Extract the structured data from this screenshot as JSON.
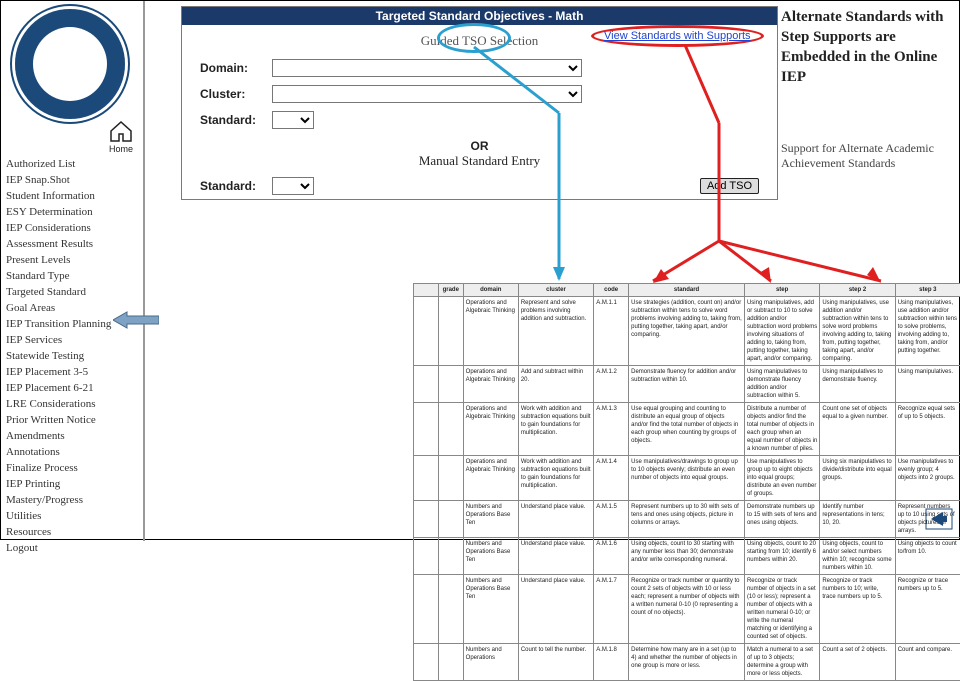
{
  "logo_alt": "West Virginia Department of Education",
  "home_label": "Home",
  "nav": {
    "items": [
      "Authorized List",
      "IEP Snap.Shot",
      "Student Information",
      "ESY Determination",
      "IEP Considerations",
      "Assessment Results",
      "Present Levels",
      "Standard Type",
      "Targeted Standard",
      "Goal Areas",
      "IEP Transition Planning",
      "IEP Services",
      "Statewide Testing",
      "IEP Placement 3-5",
      "IEP Placement 6-21",
      "LRE Considerations",
      "Prior Written Notice",
      "Amendments",
      "Annotations",
      "Finalize Process",
      "IEP Printing",
      "Mastery/Progress",
      "Utilities",
      "Resources",
      "Logout"
    ]
  },
  "form": {
    "header": "Targeted Standard Objectives - Math",
    "guided_sub": "Guided TSO Selection",
    "domain_label": "Domain:",
    "cluster_label": "Cluster:",
    "standard_label": "Standard:",
    "or_label": "OR",
    "manual_sub": "Manual Standard Entry",
    "add_btn": "Add TSO"
  },
  "link_text": "View Standards with Supports",
  "callout_text": "Alternate Standards with Step Supports are Embedded in the Online IEP",
  "support_text": "Support for Alternate Academic Achievement Standards",
  "table": {
    "headers": [
      "",
      "grade",
      "domain",
      "cluster",
      "code",
      "standard",
      "step",
      "step 2",
      "step 3"
    ],
    "rows": [
      [
        "",
        "",
        "Operations and Algebraic Thinking",
        "Represent and solve problems involving addition and subtraction.",
        "A.M.1.1",
        "Use strategies (addition, count on) and/or subtraction within tens to solve word problems involving adding to, taking from, putting together, taking apart, and/or comparing.",
        "Using manipulatives, add or subtract to 10 to solve addition and/or subtraction word problems involving situations of adding to, taking from, putting together, taking apart, and/or comparing.",
        "Using manipulatives, use addition and/or subtraction within tens to solve word problems involving adding to, taking from, putting together, taking apart, and/or comparing.",
        "Using manipulatives, use addition and/or subtraction within tens to solve problems, involving adding to, taking from, and/or putting together."
      ],
      [
        "",
        "",
        "Operations and Algebraic Thinking",
        "Add and subtract within 20.",
        "A.M.1.2",
        "Demonstrate fluency for addition and/or subtraction within 10.",
        "Using manipulatives to demonstrate fluency addition and/or subtraction within 5.",
        "Using manipulatives to demonstrate fluency.",
        "Using manipulatives."
      ],
      [
        "",
        "",
        "Operations and Algebraic Thinking",
        "Work with addition and subtraction equations built to gain foundations for multiplication.",
        "A.M.1.3",
        "Use equal grouping and counting to distribute an equal group of objects and/or find the total number of objects in each group when counting by groups of objects.",
        "Distribute a number of objects and/or find the total number of objects in each group when an equal number of objects in a known number of piles.",
        "Count one set of objects equal to a given number.",
        "Recognize equal sets of up to 5 objects."
      ],
      [
        "",
        "",
        "Operations and Algebraic Thinking",
        "Work with addition and subtraction equations built to gain foundations for multiplication.",
        "A.M.1.4",
        "Use manipulatives/drawings to group up to 10 objects evenly; distribute an even number of objects into equal groups.",
        "Use manipulatives to group up to eight objects into equal groups; distribute an even number of groups.",
        "Using six manipulatives to divide/distribute into equal groups.",
        "Use manipulatives to evenly group; 4 objects into 2 groups."
      ],
      [
        "",
        "",
        "Numbers and Operations Base Ten",
        "Understand place value.",
        "A.M.1.5",
        "Represent numbers up to 30 with sets of tens and ones using objects, picture in columns or arrays.",
        "Demonstrate numbers up to 15 with sets of tens and ones using objects.",
        "Identify number representations in tens; 10, 20.",
        "Represent numbers up to 10 using sets of objects pictures or arrays."
      ],
      [
        "",
        "",
        "Numbers and Operations Base Ten",
        "Understand place value.",
        "A.M.1.6",
        "Using objects, count to 30 starting with any number less than 30; demonstrate and/or write corresponding numeral.",
        "Using objects, count to 20 starting from 10; identify 6 numbers within 20.",
        "Using objects, count to and/or select numbers within 10; recognize some numbers within 10.",
        "Using objects to count to/from 10."
      ],
      [
        "",
        "",
        "Numbers and Operations Base Ten",
        "Understand place value.",
        "A.M.1.7",
        "Recognize or track number or quantity to count 2 sets of objects with 10 or less each; represent a number of objects with a written numeral 0-10 (0 representing a count of no objects).",
        "Recognize or track number of objects in a set (10 or less); represent a number of objects with a written numeral 0-10; or write the numeral matching or identifying a counted set of objects.",
        "Recognize or track numbers to 10; write, trace numbers up to 5.",
        "Recognize or trace numbers up to 5."
      ],
      [
        "",
        "",
        "Numbers and Operations",
        "Count to tell the number.",
        "A.M.1.8",
        "Determine how many are in a set (up to 4) and whether the number of objects in one group is more or less.",
        "Match a numeral to a set of up to 3 objects; determine a group with more or less objects.",
        "Count a set of 2 objects.",
        "Count and compare."
      ]
    ]
  }
}
